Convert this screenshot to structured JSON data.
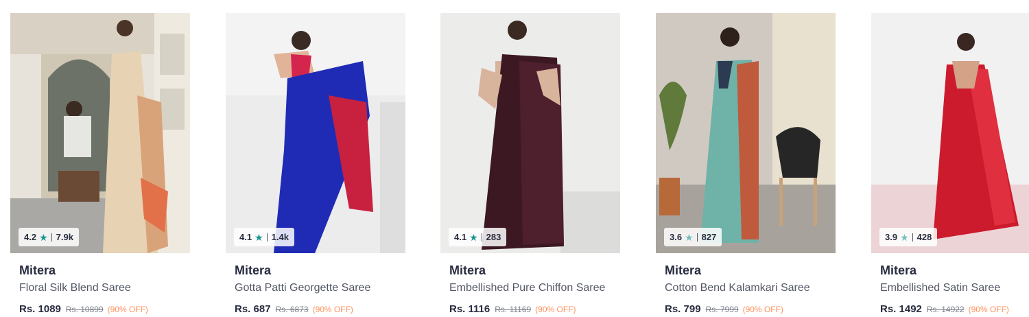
{
  "products": [
    {
      "rating": "4.2",
      "count": "7.9k",
      "brand": "Mitera",
      "name": "Floral Silk Blend Saree",
      "price": "Rs. 1089",
      "mrp": "Rs. 10899",
      "discount": "(90% OFF)",
      "image": "saree-floral-silk-blend"
    },
    {
      "rating": "4.1",
      "count": "1.4k",
      "brand": "Mitera",
      "name": "Gotta Patti Georgette Saree",
      "price": "Rs. 687",
      "mrp": "Rs. 6873",
      "discount": "(90% OFF)",
      "image": "saree-gotta-patti-georgette"
    },
    {
      "rating": "4.1",
      "count": "283",
      "brand": "Mitera",
      "name": "Embellished Pure Chiffon Saree",
      "price": "Rs. 1116",
      "mrp": "Rs. 11169",
      "discount": "(90% OFF)",
      "image": "saree-embellished-chiffon"
    },
    {
      "rating": "3.6",
      "count": "827",
      "brand": "Mitera",
      "name": "Cotton Bend Kalamkari Saree",
      "price": "Rs. 799",
      "mrp": "Rs. 7999",
      "discount": "(90% OFF)",
      "image": "saree-cotton-kalamkari"
    },
    {
      "rating": "3.9",
      "count": "428",
      "brand": "Mitera",
      "name": "Embellished Satin Saree",
      "price": "Rs. 1492",
      "mrp": "Rs. 14922",
      "discount": "(90% OFF)",
      "image": "saree-embellished-satin"
    }
  ],
  "colors": {
    "star": "#14958f",
    "discount": "#ff905a",
    "brand": "#282c3f"
  }
}
